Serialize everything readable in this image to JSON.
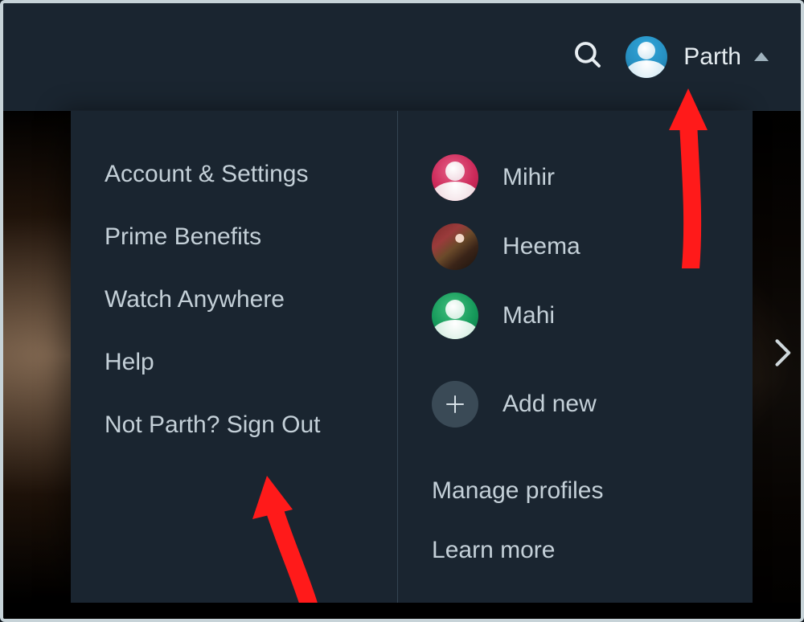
{
  "header": {
    "current_user": "Parth"
  },
  "menu": {
    "account_settings": "Account & Settings",
    "prime_benefits": "Prime Benefits",
    "watch_anywhere": "Watch Anywhere",
    "help": "Help",
    "sign_out": "Not Parth? Sign Out"
  },
  "profiles": [
    {
      "name": "Mihir",
      "avatar": "red-silhouette"
    },
    {
      "name": "Heema",
      "avatar": "photo"
    },
    {
      "name": "Mahi",
      "avatar": "green-silhouette"
    }
  ],
  "profile_actions": {
    "add_new": "Add new",
    "manage": "Manage profiles",
    "learn_more": "Learn more"
  }
}
